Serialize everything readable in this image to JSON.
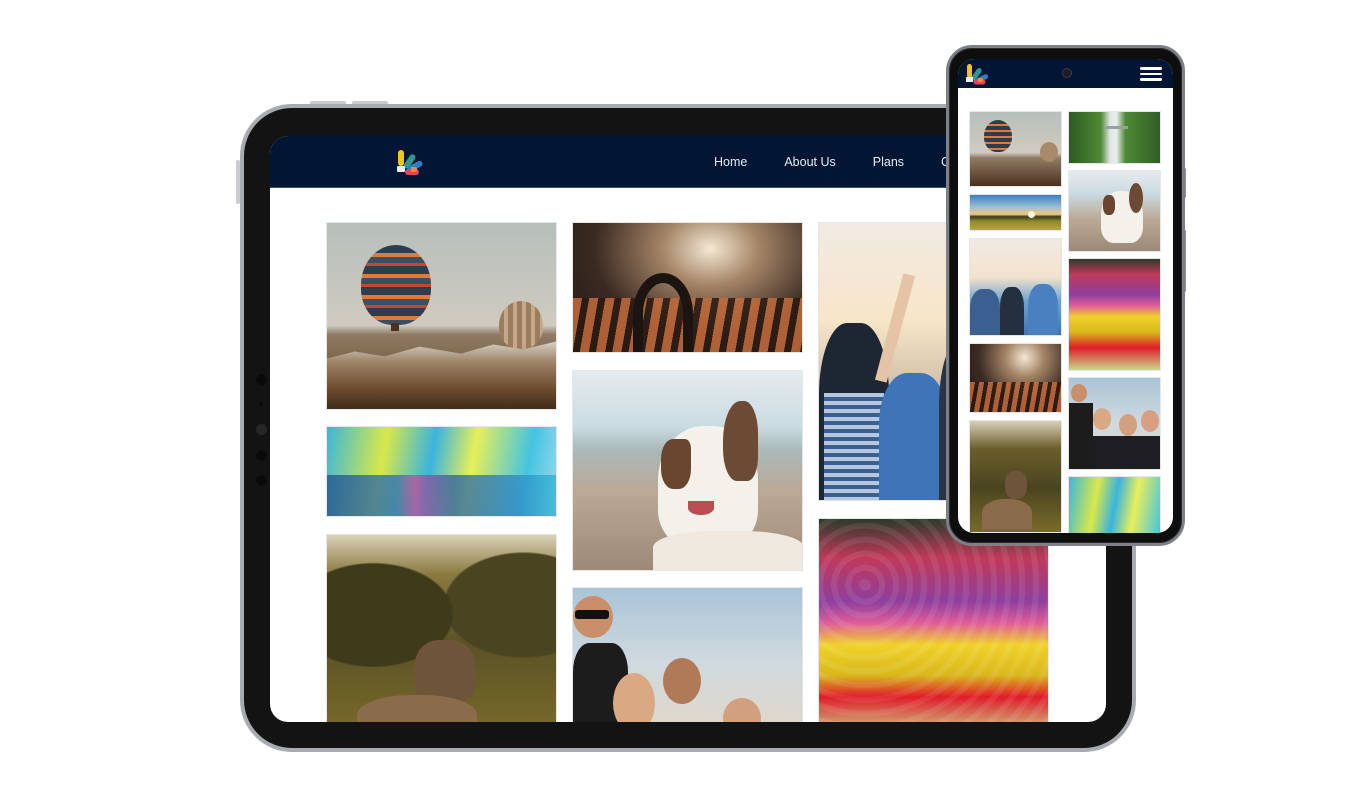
{
  "tablet": {
    "nav": {
      "logo": "colorful-fan-logo",
      "links": [
        "Home",
        "About Us",
        "Plans",
        "C"
      ]
    },
    "gallery": [
      {
        "column": 1,
        "subject": "hot-air-balloons"
      },
      {
        "column": 1,
        "subject": "color-powder-festival"
      },
      {
        "column": 1,
        "subject": "deer-in-forest"
      },
      {
        "column": 2,
        "subject": "concert-heart-hands"
      },
      {
        "column": 2,
        "subject": "dog-on-beach"
      },
      {
        "column": 2,
        "subject": "group-of-friends"
      },
      {
        "column": 3,
        "subject": "friends-raising-hands-sunset"
      },
      {
        "column": 3,
        "subject": "tulip-field"
      }
    ]
  },
  "phone": {
    "nav": {
      "logo": "colorful-fan-logo",
      "menu_icon": "hamburger-menu-icon"
    },
    "gallery": [
      {
        "column": 1,
        "subject": "hot-air-balloons"
      },
      {
        "column": 1,
        "subject": "sunset-field"
      },
      {
        "column": 1,
        "subject": "friends-raising-hands-sunset"
      },
      {
        "column": 1,
        "subject": "concert-heart-hands"
      },
      {
        "column": 1,
        "subject": "deer-in-forest"
      },
      {
        "column": 2,
        "subject": "waterfall-bridge"
      },
      {
        "column": 2,
        "subject": "dog-on-beach"
      },
      {
        "column": 2,
        "subject": "tulip-field"
      },
      {
        "column": 2,
        "subject": "group-of-friends"
      },
      {
        "column": 2,
        "subject": "color-powder-festival"
      }
    ]
  },
  "colors": {
    "nav_background": "#011634",
    "device_frame": "#131313",
    "bezel_edge": "#a8abb0",
    "logo_yellow": "#f5c518",
    "logo_teal": "#2e9a8e",
    "logo_blue": "#2f7cc4",
    "logo_red": "#e8435a",
    "logo_orange": "#f08a3c"
  }
}
